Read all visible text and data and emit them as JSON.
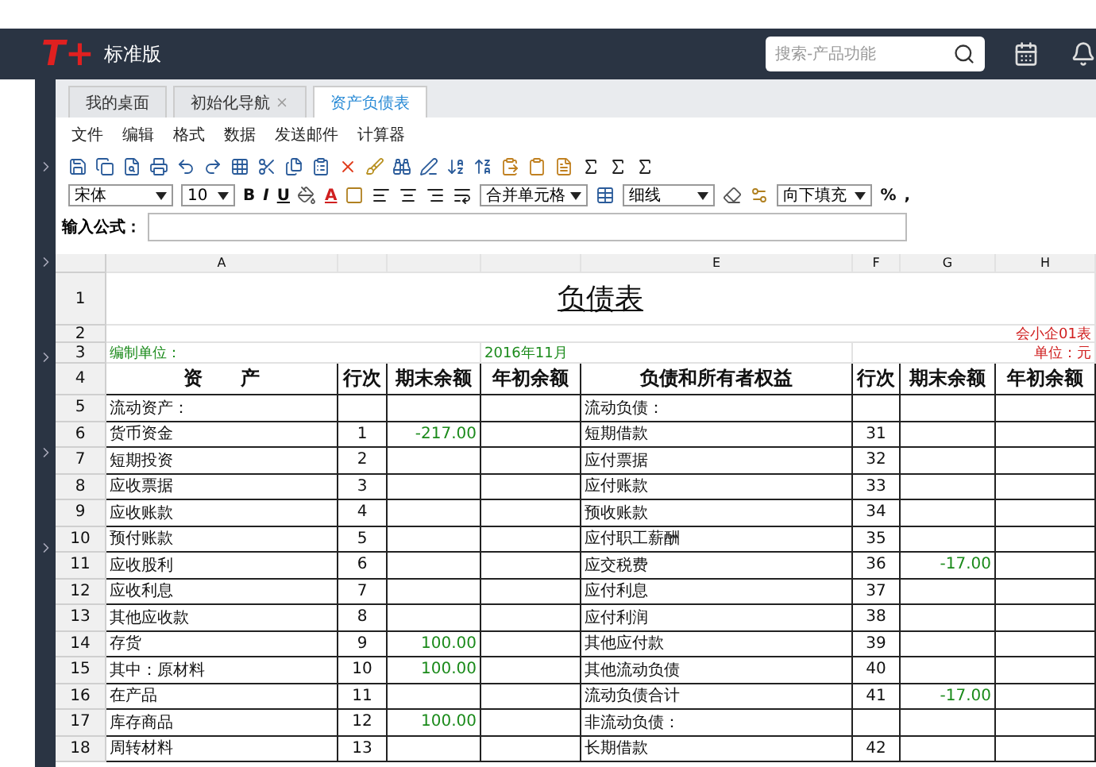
{
  "app": {
    "logo": "T+",
    "edition": "标准版"
  },
  "search": {
    "placeholder": "搜索-产品功能"
  },
  "tabs": [
    {
      "label": "我的桌面",
      "selected": false,
      "closable": false
    },
    {
      "label": "初始化导航",
      "selected": false,
      "closable": true
    },
    {
      "label": "资产负债表",
      "selected": true,
      "closable": false
    }
  ],
  "menu": [
    "文件",
    "编辑",
    "格式",
    "数据",
    "发送邮件",
    "计算器"
  ],
  "format_bar": {
    "font": "宋体",
    "size": "10",
    "bold": "B",
    "italic": "I",
    "underline": "U",
    "font_color": "A",
    "merge": "合并单元格",
    "border": "细线",
    "fill": "向下填充",
    "percent": "%",
    "comma": ","
  },
  "formula": {
    "label": "输入公式："
  },
  "sheet": {
    "top_rows": [
      "1",
      "2",
      "3",
      "4"
    ],
    "columns": [
      "A",
      "",
      "",
      "",
      "E",
      "F",
      "G",
      "H"
    ],
    "title": "负债表",
    "form_no": "会小企01表",
    "unit_label": "编制单位：",
    "period": "2016年11月",
    "currency": "单位：元",
    "header": [
      "资　　产",
      "行次",
      "期末余额",
      "年初余额",
      "负债和所有者权益",
      "行次",
      "期末余额",
      "年初余额"
    ],
    "rows": [
      {
        "n": "5",
        "a": "流动资产：",
        "b": "",
        "c": "",
        "l": "流动负债：",
        "f": "",
        "g": ""
      },
      {
        "n": "6",
        "a": "货币资金",
        "b": "1",
        "c": "-217.00",
        "l": "短期借款",
        "f": "31",
        "g": ""
      },
      {
        "n": "7",
        "a": "短期投资",
        "b": "2",
        "c": "",
        "l": "应付票据",
        "f": "32",
        "g": ""
      },
      {
        "n": "8",
        "a": "应收票据",
        "b": "3",
        "c": "",
        "l": "应付账款",
        "f": "33",
        "g": ""
      },
      {
        "n": "9",
        "a": "应收账款",
        "b": "4",
        "c": "",
        "l": "预收账款",
        "f": "34",
        "g": ""
      },
      {
        "n": "10",
        "a": "预付账款",
        "b": "5",
        "c": "",
        "l": "应付职工薪酬",
        "f": "35",
        "g": ""
      },
      {
        "n": "11",
        "a": "应收股利",
        "b": "6",
        "c": "",
        "l": "应交税费",
        "f": "36",
        "g": "-17.00"
      },
      {
        "n": "12",
        "a": "应收利息",
        "b": "7",
        "c": "",
        "l": "应付利息",
        "f": "37",
        "g": ""
      },
      {
        "n": "13",
        "a": "其他应收款",
        "b": "8",
        "c": "",
        "l": "应付利润",
        "f": "38",
        "g": ""
      },
      {
        "n": "14",
        "a": "存货",
        "b": "9",
        "c": "100.00",
        "l": "其他应付款",
        "f": "39",
        "g": ""
      },
      {
        "n": "15",
        "a": "其中：原材料",
        "b": "10",
        "c": "100.00",
        "l": "其他流动负债",
        "f": "40",
        "g": ""
      },
      {
        "n": "16",
        "a": "在产品",
        "b": "11",
        "c": "",
        "l": "流动负债合计",
        "f": "41",
        "g": "-17.00"
      },
      {
        "n": "17",
        "a": "库存商品",
        "b": "12",
        "c": "100.00",
        "l": "非流动负债：",
        "f": "",
        "g": ""
      },
      {
        "n": "18",
        "a": "周转材料",
        "b": "13",
        "c": "",
        "l": "长期借款",
        "f": "42",
        "g": ""
      }
    ]
  }
}
